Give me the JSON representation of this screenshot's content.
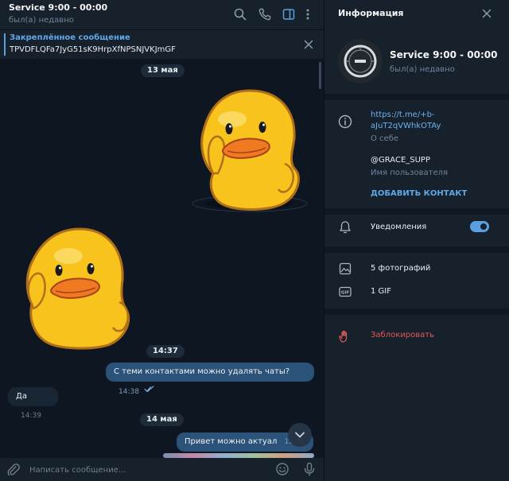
{
  "chat": {
    "title": "Service 9:00 - 00:00",
    "status": "был(а) недавно",
    "pinned": {
      "title": "Закреплённое сообщение",
      "text": "TPVDFLQFa7JyG51sK9HrpXfNPSNJVKJmGF"
    },
    "messages": {
      "date1": "13 мая",
      "time_pill": "14:37",
      "out1_text": "С теми контактами можно удалять чаты?",
      "out1_time": "14:38",
      "in1_text": "Да",
      "in1_time": "14:39",
      "date2": "14 мая",
      "out2_text": "Привет можно актуал",
      "out2_time": "13:20"
    },
    "composer_placeholder": "Написать сообщение..."
  },
  "info_panel": {
    "title": "Информация",
    "name": "Service 9:00 - 00:00",
    "status": "был(а) недавно",
    "link_line1": "https://t.me/+b-",
    "link_line2": "aJuT2qVWhkOTAy",
    "about_label": "О себе",
    "username": "@GRACE_SUPP",
    "username_label": "Имя пользователя",
    "add_contact": "ДОБАВИТЬ КОНТАКТ",
    "notifications": "Уведомления",
    "notifications_on": true,
    "photos": "5 фотографий",
    "gifs": "1 GIF",
    "block": "Заблокировать"
  },
  "colors": {
    "bg": "#0e1621",
    "panel": "#17212b",
    "accent": "#5aa0e0",
    "out_bubble": "#2b5278",
    "in_bubble": "#182533",
    "danger": "#e0585a"
  },
  "icons": [
    "search-icon",
    "phone-icon",
    "sidebar-toggle-icon",
    "more-vert-icon",
    "close-icon",
    "info-icon",
    "bell-icon",
    "photo-icon",
    "gif-icon",
    "block-hand-icon",
    "attach-icon",
    "emoji-icon",
    "mic-icon",
    "chevron-down-icon"
  ]
}
